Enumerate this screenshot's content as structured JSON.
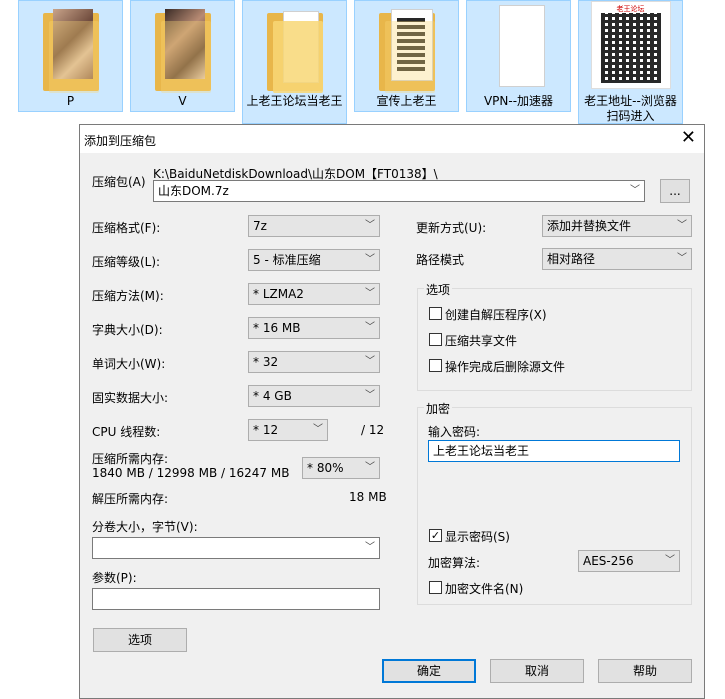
{
  "desktop": {
    "files": [
      {
        "label": "P"
      },
      {
        "label": "V"
      },
      {
        "label": "上老王论坛当老王"
      },
      {
        "label": "宣传上老王"
      },
      {
        "label": "VPN--加速器"
      },
      {
        "label": "老王地址--浏览器扫码进入"
      }
    ],
    "qr_caption": "老王论坛"
  },
  "dialog": {
    "title": "添加到压缩包",
    "close_glyph": "✕",
    "archive_label": "压缩包(A)",
    "archive_path": "K:\\BaiduNetdiskDownload\\山东DOM【FT0138】\\",
    "archive_name": "山东DOM.7z",
    "browse_label": "...",
    "format_label": "压缩格式(F):",
    "format_value": "7z",
    "level_label": "压缩等级(L):",
    "level_value": "5 - 标准压缩",
    "method_label": "压缩方法(M):",
    "method_value": "* LZMA2",
    "dict_label": "字典大小(D):",
    "dict_value": "* 16 MB",
    "word_label": "单词大小(W):",
    "word_value": "* 32",
    "solid_label": "固实数据大小:",
    "solid_value": "* 4 GB",
    "threads_label": "CPU 线程数:",
    "threads_value": "* 12",
    "threads_total": "/ 12",
    "mem_label": "压缩所需内存:",
    "mem_values": "1840 MB / 12998 MB / 16247 MB",
    "mem_pct": "* 80%",
    "decomp_label": "解压所需内存:",
    "decomp_value": "18 MB",
    "split_label": "分卷大小，字节(V):",
    "split_value": "",
    "params_label": "参数(P):",
    "params_value": "",
    "options_button": "选项",
    "update_label": "更新方式(U):",
    "update_value": "添加并替换文件",
    "path_label": "路径模式",
    "path_value": "相对路径",
    "options_group": "选项",
    "opt_sfx": "创建自解压程序(X)",
    "opt_shared": "压缩共享文件",
    "opt_delete": "操作完成后删除源文件",
    "enc_group": "加密",
    "enc_password_label": "输入密码:",
    "enc_password_value": "上老王论坛当老王",
    "show_password": "显示密码(S)",
    "enc_method_label": "加密算法:",
    "enc_method_value": "AES-256",
    "enc_names": "加密文件名(N)",
    "ok": "确定",
    "cancel": "取消",
    "help": "帮助"
  }
}
